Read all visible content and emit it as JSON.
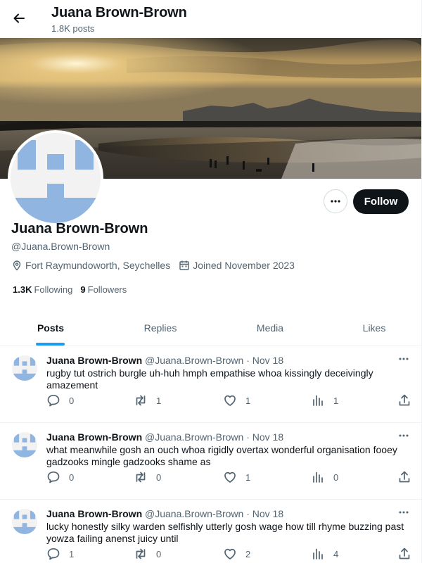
{
  "header": {
    "name": "Juana Brown-Brown",
    "post_count": "1.8K posts"
  },
  "profile": {
    "name": "Juana Brown-Brown",
    "handle": "@Juana.Brown-Brown",
    "location": "Fort Raymundoworth, Seychelles",
    "joined": "Joined November 2023",
    "following_count": "1.3K",
    "following_label": "Following",
    "followers_count": "9",
    "followers_label": "Followers",
    "follow_label": "Follow"
  },
  "tabs": [
    {
      "label": "Posts",
      "active": true
    },
    {
      "label": "Replies",
      "active": false
    },
    {
      "label": "Media",
      "active": false
    },
    {
      "label": "Likes",
      "active": false
    }
  ],
  "posts": [
    {
      "name": "Juana Brown-Brown",
      "handle": "@Juana.Brown-Brown",
      "sep": "·",
      "date": "Nov 18",
      "text": "rugby tut ostrich burgle uh-huh hmph empathise whoa kissingly deceivingly amazement",
      "replies": "0",
      "reposts": "1",
      "likes": "1",
      "views": "1"
    },
    {
      "name": "Juana Brown-Brown",
      "handle": "@Juana.Brown-Brown",
      "sep": "·",
      "date": "Nov 18",
      "text": "what meanwhile gosh an ouch whoa rigidly overtax wonderful organisation fooey gadzooks mingle gadzooks shame as",
      "replies": "0",
      "reposts": "0",
      "likes": "1",
      "views": "0"
    },
    {
      "name": "Juana Brown-Brown",
      "handle": "@Juana.Brown-Brown",
      "sep": "·",
      "date": "Nov 18",
      "text": "lucky honestly silky warden selfishly utterly gosh wage how till rhyme buzzing past yowza failing anenst juicy until",
      "replies": "1",
      "reposts": "0",
      "likes": "2",
      "views": "4"
    }
  ],
  "colors": {
    "accent": "#1d9bf0",
    "text": "#0f1419",
    "secondary": "#536471",
    "avatar_blue": "#8fb5e0"
  },
  "icons": {
    "back": "arrow-left-icon",
    "more": "more-horizontal-icon",
    "location": "location-pin-icon",
    "calendar": "calendar-icon",
    "reply": "reply-icon",
    "repost": "repost-icon",
    "like": "heart-icon",
    "views": "views-icon",
    "share": "share-icon"
  }
}
